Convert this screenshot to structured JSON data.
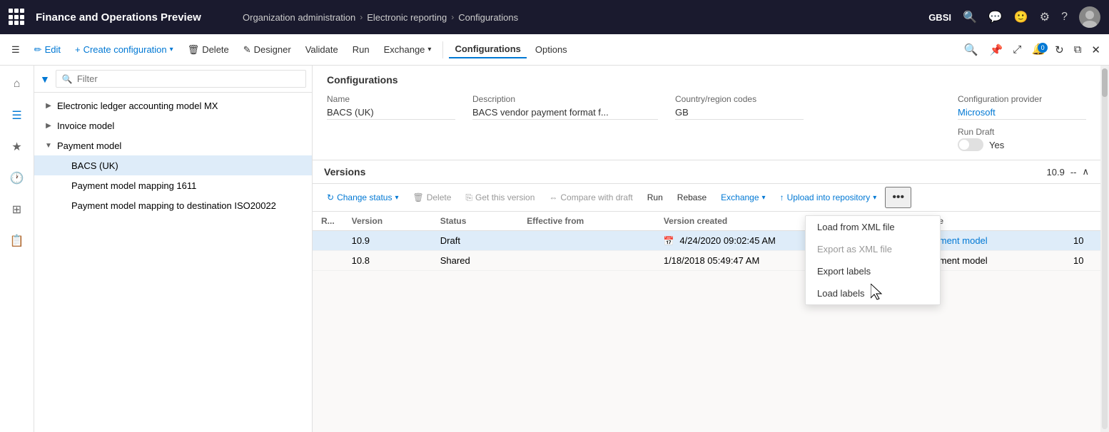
{
  "app": {
    "title": "Finance and Operations Preview",
    "org": "GBSI"
  },
  "breadcrumb": {
    "items": [
      {
        "label": "Organization administration"
      },
      {
        "label": "Electronic reporting"
      },
      {
        "label": "Configurations"
      }
    ]
  },
  "toolbar": {
    "edit": "Edit",
    "create": "Create configuration",
    "delete": "Delete",
    "designer": "Designer",
    "validate": "Validate",
    "run": "Run",
    "exchange": "Exchange",
    "configurations": "Configurations",
    "options": "Options"
  },
  "tree": {
    "filter_placeholder": "Filter",
    "items": [
      {
        "label": "Electronic ledger accounting model MX",
        "indent": 1,
        "expanded": false
      },
      {
        "label": "Invoice model",
        "indent": 1,
        "expanded": false
      },
      {
        "label": "Payment model",
        "indent": 1,
        "expanded": true
      },
      {
        "label": "BACS (UK)",
        "indent": 2,
        "selected": true
      },
      {
        "label": "Payment model mapping 1611",
        "indent": 2
      },
      {
        "label": "Payment model mapping to destination ISO20022",
        "indent": 2
      }
    ]
  },
  "detail": {
    "section_title": "Configurations",
    "name_label": "Name",
    "name_value": "BACS (UK)",
    "description_label": "Description",
    "description_value": "BACS vendor payment format f...",
    "country_label": "Country/region codes",
    "country_value": "GB",
    "provider_label": "Configuration provider",
    "provider_value": "Microsoft",
    "run_draft_label": "Run Draft",
    "run_draft_toggle": "off",
    "run_draft_value": "Yes"
  },
  "versions": {
    "title": "Versions",
    "pagination_current": "10.9",
    "pagination_sep": "--",
    "toolbar": {
      "change_status": "Change status",
      "delete": "Delete",
      "get_this_version": "Get this version",
      "compare": "Compare with draft",
      "run": "Run",
      "rebase": "Rebase",
      "exchange": "Exchange",
      "upload": "Upload into repository"
    },
    "table": {
      "columns": [
        "R...",
        "Version",
        "Status",
        "Effective from",
        "Version created",
        "",
        "Base",
        ""
      ],
      "rows": [
        {
          "r": "",
          "version": "10.9",
          "status": "Draft",
          "effective_from": "",
          "version_created": "4/24/2020 09:02:45 AM",
          "has_cal": true,
          "base": "Payment model",
          "base_num": "10",
          "selected": true
        },
        {
          "r": "",
          "version": "10.8",
          "status": "Shared",
          "effective_from": "",
          "version_created": "1/18/2018 05:49:47 AM",
          "has_cal": false,
          "base": "Payment model",
          "base_num": "10",
          "selected": false
        }
      ]
    }
  },
  "exchange_dropdown": {
    "items": [
      {
        "label": "Load from XML file",
        "disabled": false
      },
      {
        "label": "Export as XML file",
        "disabled": true
      },
      {
        "label": "Export labels",
        "disabled": false
      },
      {
        "label": "Load labels",
        "disabled": false
      }
    ]
  },
  "icons": {
    "waffle": "⊞",
    "search": "🔍",
    "chat": "💬",
    "emoji": "🙂",
    "settings": "⚙",
    "help": "?",
    "hamburger": "☰",
    "home": "⌂",
    "star": "★",
    "clock": "🕐",
    "grid": "⊞",
    "list": "☰",
    "filter": "▼",
    "chevron_right": "›",
    "chevron_down": "∨",
    "collapse": "∧",
    "triangle_right": "▶",
    "triangle_down": "▼",
    "refresh": "↻",
    "upload": "↑",
    "compare": "⇔",
    "calendar": "📅",
    "edit_pen": "✏",
    "plus": "+",
    "trash": "🗑",
    "designer": "📐",
    "check": "✓",
    "ellipsis": "•••",
    "pin": "📌",
    "expand": "⤢",
    "close": "✕",
    "back": "←",
    "forward": "→"
  }
}
